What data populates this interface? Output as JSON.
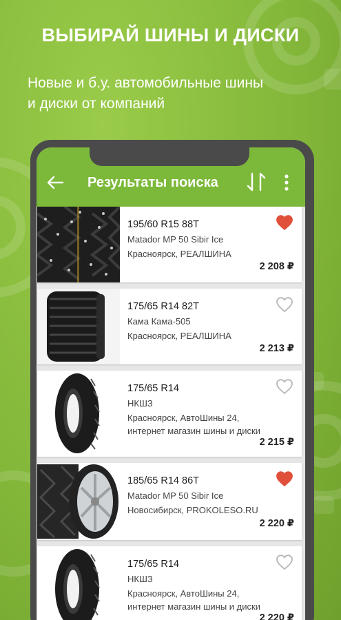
{
  "promo": {
    "headline": "ВЫБИРАЙ ШИНЫ И ДИСКИ",
    "subline_line1": "Новые и б.у. автомобильные шины",
    "subline_line2": "и диски от компаний"
  },
  "appbar": {
    "title": "Результаты поиска",
    "back_icon": "arrow-left-icon",
    "sort_icon": "sort-arrows-icon",
    "more_icon": "more-vert-icon"
  },
  "colors": {
    "background": "#8cbf3f",
    "appbar": "#7cb93a",
    "heart_active": "#e0503a",
    "heart_inactive": "#b5b5b5"
  },
  "results": [
    {
      "size": "195/60 R15 88T",
      "model": "Matador MP 50 Sibir Ice",
      "location_line1": "Красноярск, РЕАЛШИНА",
      "location_line2": "",
      "price": "2 208 ₽",
      "favorite": true
    },
    {
      "size": "175/65 R14 82T",
      "model": "Кама Кама-505",
      "location_line1": "Красноярск, РЕАЛШИНА",
      "location_line2": "",
      "price": "2 213 ₽",
      "favorite": false
    },
    {
      "size": "175/65 R14",
      "model": "НКШЗ",
      "location_line1": "Красноярск, АвтоШины 24,",
      "location_line2": "интернет магазин шины и диски",
      "price": "2 215 ₽",
      "favorite": false
    },
    {
      "size": "185/65 R14 86T",
      "model": "Matador MP 50 Sibir Ice",
      "location_line1": "Новосибирск, PROKOLESO.RU",
      "location_line2": "",
      "price": "2 220 ₽",
      "favorite": true
    },
    {
      "size": "175/65 R14",
      "model": "НКШЗ",
      "location_line1": "Красноярск, АвтоШины 24,",
      "location_line2": "интернет магазин шины и диски",
      "price": "2 220 ₽",
      "favorite": false
    }
  ]
}
